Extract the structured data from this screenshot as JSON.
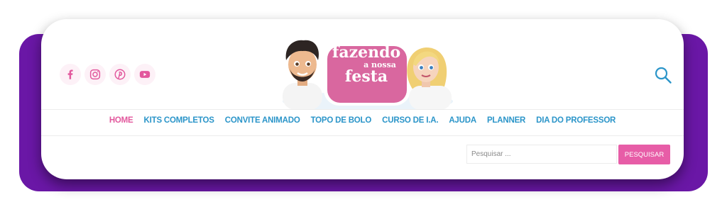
{
  "brand": {
    "logo_line1": "fazendo",
    "logo_line2": "a nossa",
    "logo_line3": "festa",
    "colors": {
      "pink": "#e2589d",
      "blue": "#2b95c9",
      "purple": "#6a17a6"
    }
  },
  "social": [
    {
      "name": "facebook-icon"
    },
    {
      "name": "instagram-icon"
    },
    {
      "name": "pinterest-icon"
    },
    {
      "name": "youtube-icon"
    }
  ],
  "nav": {
    "items": [
      {
        "label": "HOME",
        "active": true
      },
      {
        "label": "KITS COMPLETOS"
      },
      {
        "label": "CONVITE ANIMADO"
      },
      {
        "label": "TOPO DE BOLO"
      },
      {
        "label": "CURSO DE I.A."
      },
      {
        "label": "AJUDA"
      },
      {
        "label": "PLANNER"
      },
      {
        "label": "DIA DO PROFESSOR"
      }
    ]
  },
  "search": {
    "placeholder": "Pesquisar ...",
    "button_label": "PESQUISAR"
  }
}
